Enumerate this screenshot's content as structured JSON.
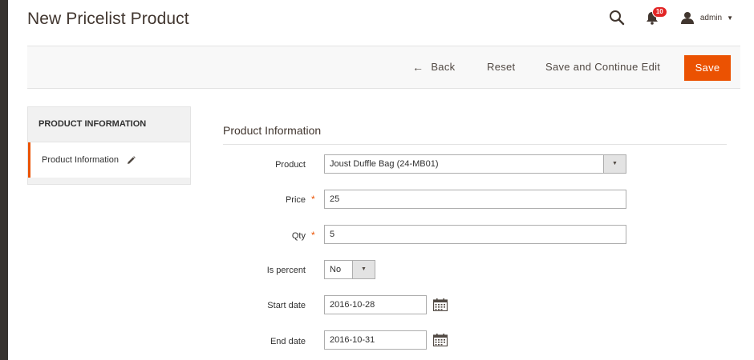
{
  "page": {
    "title": "New Pricelist Product"
  },
  "header": {
    "notifications_count": "10",
    "user_name": "admin"
  },
  "toolbar": {
    "back_label": "Back",
    "reset_label": "Reset",
    "save_continue_label": "Save and Continue Edit",
    "save_label": "Save",
    "accent_color": "#eb5202"
  },
  "tabs": {
    "title": "PRODUCT INFORMATION",
    "items": [
      {
        "label": "Product Information"
      }
    ]
  },
  "form": {
    "section_title": "Product Information",
    "product": {
      "label": "Product",
      "value": "Joust Duffle Bag (24-MB01)"
    },
    "price": {
      "label": "Price",
      "value": "25",
      "required": true
    },
    "qty": {
      "label": "Qty",
      "value": "5",
      "required": true
    },
    "is_percent": {
      "label": "Is percent",
      "value": "No"
    },
    "start_date": {
      "label": "Start date",
      "value": "2016-10-28"
    },
    "end_date": {
      "label": "End date",
      "value": "2016-10-31"
    }
  }
}
